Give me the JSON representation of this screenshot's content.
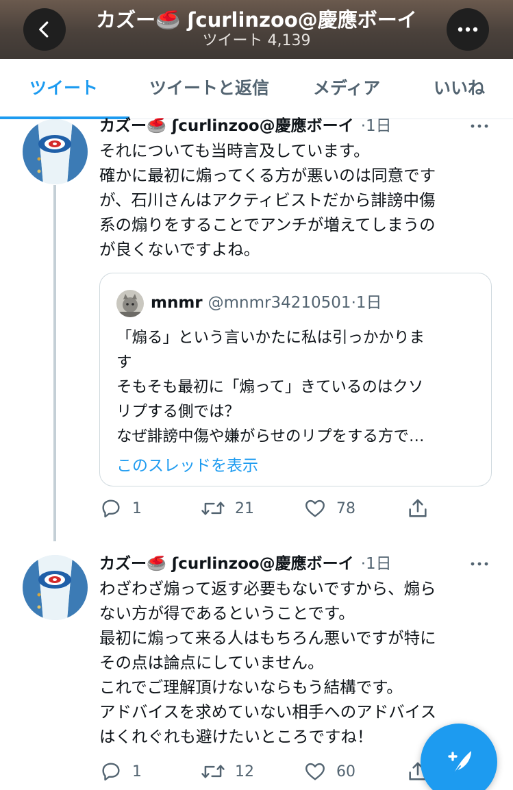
{
  "header": {
    "title": "カズー🥌 ʃcurlinzoo@慶應ボーイ",
    "subtitle": "ツイート 4,139"
  },
  "tabs": [
    {
      "label": "ツイート",
      "active": true
    },
    {
      "label": "ツイートと返信",
      "active": false
    },
    {
      "label": "メディア",
      "active": false
    },
    {
      "label": "いいね",
      "active": false
    }
  ],
  "tweets": [
    {
      "author": "カズー🥌 ʃcurlinzoo@慶應ボーイ",
      "time": "·1日",
      "lines": [
        "それについても当時言及しています。",
        "確かに最初に煽ってくる方が悪いのは同意です",
        "が、石川さんはアクティビストだから誹謗中傷",
        "系の煽りをすることでアンチが増えてしまうの",
        "が良くないですよね。"
      ],
      "quote": {
        "name": "mnmr",
        "handle": "@mnmr34210501·1日",
        "lines": [
          "「煽る」という言いかたに私は引っかかりま",
          "す",
          "そもそも最初に「煽って」きているのはクソ",
          "リプする側では？",
          "なぜ誹謗中傷や嫌がらせのリプをする方で…"
        ],
        "link": "このスレッドを表示"
      },
      "replies": "1",
      "retweets": "21",
      "likes": "78"
    },
    {
      "author": "カズー🥌 ʃcurlinzoo@慶應ボーイ",
      "time": "·1日",
      "lines": [
        "わざわざ煽って返す必要もないですから、煽ら",
        "ない方が得であるということです。",
        "最初に煽って来る人はもちろん悪いですが特に",
        "その点は論点にしていません。",
        "これでご理解頂けないならもう結構です。",
        "アドバイスを求めていない相手へのアドバイス",
        "はくれぐれも避けたいところですね！"
      ],
      "replies": "1",
      "retweets": "12",
      "likes": "60"
    }
  ],
  "icons": {
    "back": "chevron-left-icon",
    "more": "more-horizontal-icon",
    "reply": "reply-icon",
    "retweet": "retweet-icon",
    "like": "heart-icon",
    "share": "share-icon",
    "compose": "compose-tweet-icon"
  },
  "colors": {
    "accent": "#1d9bf0",
    "text": "#0f1419",
    "muted": "#536471",
    "header_bg": "#4a413b"
  }
}
